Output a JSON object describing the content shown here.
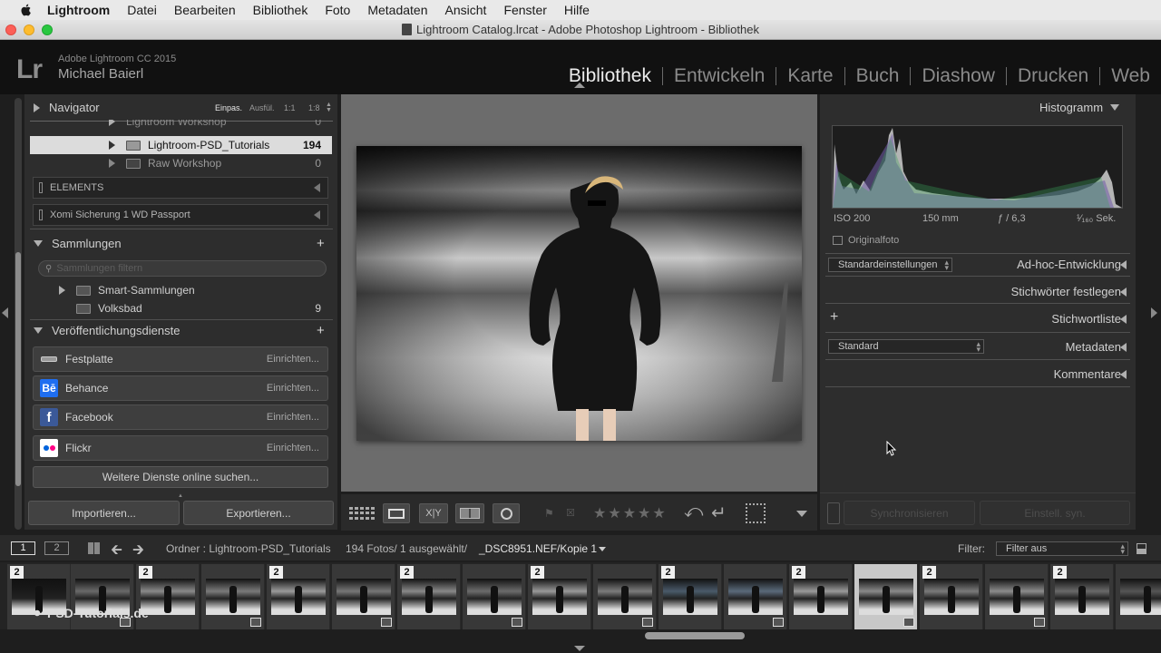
{
  "menubar": {
    "app": "Lightroom",
    "items": [
      "Datei",
      "Bearbeiten",
      "Bibliothek",
      "Foto",
      "Metadaten",
      "Ansicht",
      "Fenster",
      "Hilfe"
    ]
  },
  "window": {
    "title": "Lightroom Catalog.lrcat - Adobe Photoshop Lightroom - Bibliothek"
  },
  "identity": {
    "logo": "Lr",
    "version": "Adobe Lightroom CC 2015",
    "user": "Michael Baierl"
  },
  "modules": [
    "Bibliothek",
    "Entwickeln",
    "Karte",
    "Buch",
    "Diashow",
    "Drucken",
    "Web"
  ],
  "active_module": "Bibliothek",
  "left": {
    "navigator": {
      "title": "Navigator",
      "zoom": [
        "Einpas.",
        "Ausfül.",
        "1:1",
        "1:8"
      ]
    },
    "folders": [
      {
        "name": "Lightroom Workshop",
        "count": "0"
      },
      {
        "name": "Lightroom-PSD_Tutorials",
        "count": "194"
      },
      {
        "name": "Raw Workshop",
        "count": "0"
      }
    ],
    "volumes": [
      "ELEMENTS",
      "Xomi Sicherung 1 WD Passport"
    ],
    "collections": {
      "title": "Sammlungen",
      "search_placeholder": "Sammlungen filtern",
      "items": [
        {
          "name": "Smart-Sammlungen",
          "count": ""
        },
        {
          "name": "Volksbad",
          "count": "9"
        }
      ]
    },
    "publish": {
      "title": "Veröffentlichungsdienste",
      "services": [
        {
          "name": "Festplatte",
          "action": "Einrichten..."
        },
        {
          "name": "Behance",
          "action": "Einrichten..."
        },
        {
          "name": "Facebook",
          "action": "Einrichten..."
        },
        {
          "name": "Flickr",
          "action": "Einrichten..."
        }
      ],
      "more": "Weitere Dienste online suchen..."
    },
    "import_label": "Importieren...",
    "export_label": "Exportieren..."
  },
  "right": {
    "histogram_title": "Histogramm",
    "exif": {
      "iso": "ISO 200",
      "focal": "150 mm",
      "aperture": "ƒ / 6,3",
      "shutter": "¹⁄₁₆₀ Sek."
    },
    "original_photo": "Originalfoto",
    "preset_value": "Standardeinstellungen",
    "quick_develop": "Ad-hoc-Entwicklung",
    "keywording": "Stichwörter festlegen",
    "keyword_list": "Stichwortliste",
    "metadata_value": "Standard",
    "metadata": "Metadaten",
    "comments": "Kommentare",
    "sync_metadata": "Synchronisieren",
    "sync_settings": "Einstell. syn."
  },
  "toolbar": {
    "compare_label": "X|Y"
  },
  "filmstrip": {
    "pages": [
      "1",
      "2"
    ],
    "source": "Ordner : Lightroom-PSD_Tutorials",
    "stats": "194 Fotos/ 1 ausgewählt/",
    "file": "_DSC8951.NEF/Kopie 1",
    "filter_label": "Filter:",
    "filter_value": "Filter aus",
    "stack_badge": "2"
  },
  "watermark": "PSD-Tutorials.de"
}
